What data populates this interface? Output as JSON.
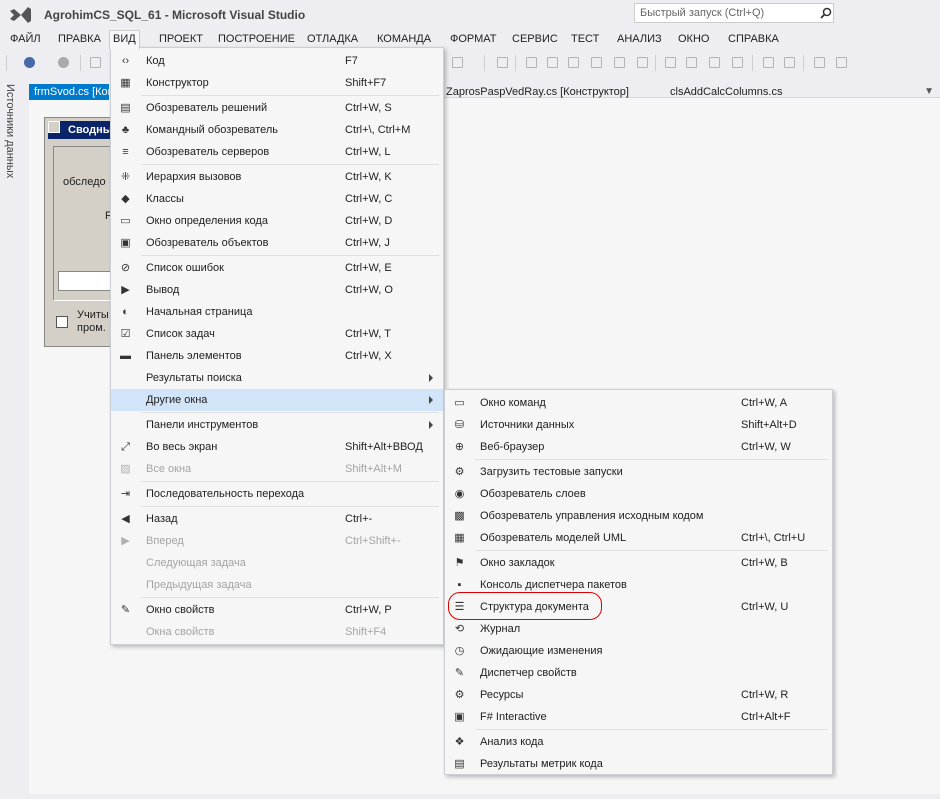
{
  "app": {
    "title": "AgrohimCS_SQL_61 - Microsoft Visual Studio",
    "quick_launch_placeholder": "Быстрый запуск (Ctrl+Q)"
  },
  "menubar": [
    "ФАЙЛ",
    "ПРАВКА",
    "ВИД",
    "ПРОЕКТ",
    "ПОСТРОЕНИЕ",
    "ОТЛАДКА",
    "КОМАНДА",
    "ФОРМАТ",
    "СЕРВИС",
    "ТЕСТ",
    "АНАЛИЗ",
    "ОКНО",
    "СПРАВКА"
  ],
  "side_panel": {
    "label": "Источники данных"
  },
  "tabs": {
    "active": "frmSvod.cs [Конструктор]",
    "others": [
      "ZaprosPaspVedRay.cs [Конструктор]",
      "clsAddCalcColumns.cs"
    ]
  },
  "designer_form": {
    "title": "Сводный",
    "label1": "обследо",
    "label2": "F",
    "checkbox_label": "Учиты\nпром."
  },
  "view_menu": [
    {
      "label": "Код",
      "shortcut": "F7",
      "icon": "code-icon"
    },
    {
      "label": "Конструктор",
      "shortcut": "Shift+F7",
      "icon": "designer-icon",
      "sep_after": true
    },
    {
      "label": "Обозреватель решений",
      "shortcut": "Ctrl+W, S",
      "icon": "solution-explorer-icon"
    },
    {
      "label": "Командный обозреватель",
      "shortcut": "Ctrl+\\, Ctrl+M",
      "icon": "team-explorer-icon"
    },
    {
      "label": "Обозреватель серверов",
      "shortcut": "Ctrl+W, L",
      "icon": "server-explorer-icon",
      "sep_after": true
    },
    {
      "label": "Иерархия вызовов",
      "shortcut": "Ctrl+W, K",
      "icon": "call-hierarchy-icon"
    },
    {
      "label": "Классы",
      "shortcut": "Ctrl+W, C",
      "icon": "class-view-icon"
    },
    {
      "label": "Окно определения кода",
      "shortcut": "Ctrl+W, D",
      "icon": "code-definition-icon"
    },
    {
      "label": "Обозреватель объектов",
      "shortcut": "Ctrl+W, J",
      "icon": "object-browser-icon",
      "sep_after": true
    },
    {
      "label": "Список ошибок",
      "shortcut": "Ctrl+W, E",
      "icon": "error-list-icon"
    },
    {
      "label": "Вывод",
      "shortcut": "Ctrl+W, O",
      "icon": "output-icon"
    },
    {
      "label": "Начальная страница",
      "shortcut": "",
      "icon": "start-page-icon"
    },
    {
      "label": "Список задач",
      "shortcut": "Ctrl+W, T",
      "icon": "task-list-icon"
    },
    {
      "label": "Панель элементов",
      "shortcut": "Ctrl+W, X",
      "icon": "toolbox-icon"
    },
    {
      "label": "Результаты поиска",
      "shortcut": "",
      "icon": "",
      "submenu": true
    },
    {
      "label": "Другие окна",
      "shortcut": "",
      "icon": "",
      "submenu": true,
      "highlighted": true,
      "sep_after": true
    },
    {
      "label": "Панели инструментов",
      "shortcut": "",
      "icon": "",
      "submenu": true
    },
    {
      "label": "Во весь экран",
      "shortcut": "Shift+Alt+ВВОД",
      "icon": "full-screen-icon"
    },
    {
      "label": "Все окна",
      "shortcut": "Shift+Alt+M",
      "icon": "all-windows-icon",
      "disabled": true,
      "sep_after": true
    },
    {
      "label": "Последовательность перехода",
      "shortcut": "",
      "icon": "tab-order-icon",
      "sep_after": true
    },
    {
      "label": "Назад",
      "shortcut": "Ctrl+-",
      "icon": "back-icon"
    },
    {
      "label": "Вперед",
      "shortcut": "Ctrl+Shift+-",
      "icon": "forward-icon",
      "disabled": true
    },
    {
      "label": "Следующая задача",
      "shortcut": "",
      "icon": "",
      "disabled": true
    },
    {
      "label": "Предыдущая задача",
      "shortcut": "",
      "icon": "",
      "disabled": true,
      "sep_after": true
    },
    {
      "label": "Окно свойств",
      "shortcut": "Ctrl+W, P",
      "icon": "properties-icon"
    },
    {
      "label": "Окна свойств",
      "shortcut": "Shift+F4",
      "icon": "",
      "disabled": true
    }
  ],
  "other_windows_menu": [
    {
      "label": "Окно команд",
      "shortcut": "Ctrl+W, A",
      "icon": "command-window-icon"
    },
    {
      "label": "Источники данных",
      "shortcut": "Shift+Alt+D",
      "icon": "data-sources-icon"
    },
    {
      "label": "Веб-браузер",
      "shortcut": "Ctrl+W, W",
      "icon": "web-browser-icon",
      "sep_after": true
    },
    {
      "label": "Загрузить тестовые запуски",
      "shortcut": "",
      "icon": "load-test-icon"
    },
    {
      "label": "Обозреватель слоев",
      "shortcut": "",
      "icon": "layer-explorer-icon"
    },
    {
      "label": "Обозреватель управления исходным кодом",
      "shortcut": "",
      "icon": "source-control-icon"
    },
    {
      "label": "Обозреватель моделей UML",
      "shortcut": "Ctrl+\\, Ctrl+U",
      "icon": "uml-explorer-icon",
      "sep_after": true
    },
    {
      "label": "Окно закладок",
      "shortcut": "Ctrl+W, B",
      "icon": "bookmarks-icon"
    },
    {
      "label": "Консоль диспетчера пакетов",
      "shortcut": "",
      "icon": "package-console-icon"
    },
    {
      "label": "Структура документа",
      "shortcut": "Ctrl+W, U",
      "icon": "document-outline-icon"
    },
    {
      "label": "Журнал",
      "shortcut": "",
      "icon": "history-icon"
    },
    {
      "label": "Ожидающие изменения",
      "shortcut": "",
      "icon": "pending-changes-icon"
    },
    {
      "label": "Диспетчер свойств",
      "shortcut": "",
      "icon": "property-manager-icon"
    },
    {
      "label": "Ресурсы",
      "shortcut": "Ctrl+W, R",
      "icon": "resources-icon"
    },
    {
      "label": "F# Interactive",
      "shortcut": "Ctrl+Alt+F",
      "icon": "fsharp-icon",
      "sep_after": true
    },
    {
      "label": "Анализ кода",
      "shortcut": "",
      "icon": "code-analysis-icon"
    },
    {
      "label": "Результаты метрик кода",
      "shortcut": "",
      "icon": "code-metrics-icon"
    }
  ],
  "colors": {
    "accent": "#007acc",
    "highlight": "#d2e4f7",
    "annotation": "#dd0000"
  }
}
